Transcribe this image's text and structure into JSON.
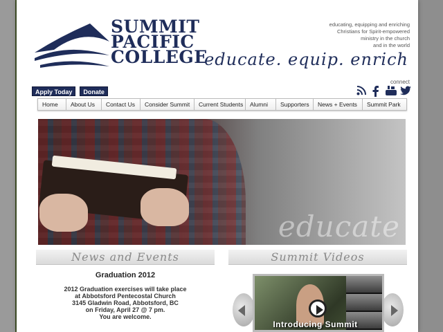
{
  "header": {
    "logo_lines": [
      "SUMMIT",
      "PACIFIC",
      "COLLEGE"
    ],
    "tagline_small": [
      "educating, equipping and enriching",
      "Christians for Spirit-empowered",
      "ministry in the church",
      "and in the world"
    ],
    "tagline_big": "educate. equip. enrich"
  },
  "actions": {
    "apply": "Apply Today",
    "donate": "Donate"
  },
  "connect": {
    "label": "connect"
  },
  "nav": [
    "Home",
    "About Us",
    "Contact Us",
    "Consider Summit",
    "Current Students",
    "Alumni",
    "Supporters",
    "News + Events",
    "Summit Park"
  ],
  "hero": {
    "word": "educate"
  },
  "news": {
    "banner": "News and Events",
    "title": "Graduation 2012",
    "body": [
      "2012 Graduation exercises will take place",
      "at Abbotsford Pentecostal Church",
      "3145 Gladwin Road, Abbotsford, BC",
      "on Friday, April 27 @ 7 pm.",
      "You are welcome."
    ]
  },
  "videos": {
    "banner": "Summit Videos",
    "caption": "Introducing Summit"
  },
  "colors": {
    "brand_navy": "#1f2d5a"
  }
}
